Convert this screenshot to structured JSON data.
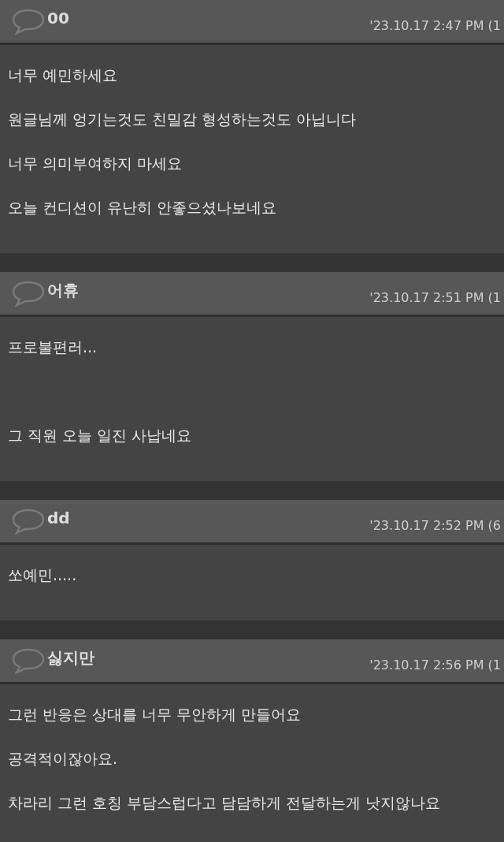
{
  "posts": [
    {
      "author": "00",
      "time": "'23.10.17 2:47 PM (1",
      "paragraphs": [
        [
          "너무 예민하세요",
          "원글님께 엉기는것도 친밀감 형성하는것도 아닙니다",
          "너무 의미부여하지 마세요",
          "오늘 컨디션이 유난히 안좋으셨나보네요"
        ]
      ]
    },
    {
      "author": "어휴",
      "time": "'23.10.17 2:51 PM (1",
      "paragraphs": [
        [
          "프로불편러..."
        ],
        [
          "그 직원 오늘 일진 사납네요"
        ]
      ]
    },
    {
      "author": "dd",
      "time": "'23.10.17 2:52 PM (6",
      "paragraphs": [
        [
          "쏘예민....."
        ]
      ]
    },
    {
      "author": "싫지만",
      "time": "'23.10.17 2:56 PM (1",
      "paragraphs": [
        [
          "그런 반응은 상대를 너무 무안하게 만들어요",
          "공격적이잖아요.",
          "차라리 그런 호칭 부담스럽다고 담담하게 전달하는게 낫지않나요"
        ]
      ]
    }
  ]
}
